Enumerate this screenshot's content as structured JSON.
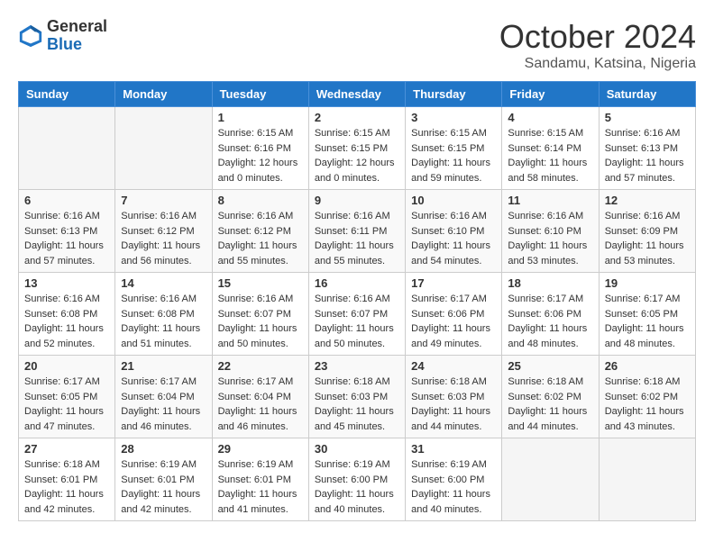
{
  "logo": {
    "general": "General",
    "blue": "Blue"
  },
  "title": "October 2024",
  "location": "Sandamu, Katsina, Nigeria",
  "headers": [
    "Sunday",
    "Monday",
    "Tuesday",
    "Wednesday",
    "Thursday",
    "Friday",
    "Saturday"
  ],
  "weeks": [
    [
      {
        "day": "",
        "info": ""
      },
      {
        "day": "",
        "info": ""
      },
      {
        "day": "1",
        "info": "Sunrise: 6:15 AM\nSunset: 6:16 PM\nDaylight: 12 hours\nand 0 minutes."
      },
      {
        "day": "2",
        "info": "Sunrise: 6:15 AM\nSunset: 6:15 PM\nDaylight: 12 hours\nand 0 minutes."
      },
      {
        "day": "3",
        "info": "Sunrise: 6:15 AM\nSunset: 6:15 PM\nDaylight: 11 hours\nand 59 minutes."
      },
      {
        "day": "4",
        "info": "Sunrise: 6:15 AM\nSunset: 6:14 PM\nDaylight: 11 hours\nand 58 minutes."
      },
      {
        "day": "5",
        "info": "Sunrise: 6:16 AM\nSunset: 6:13 PM\nDaylight: 11 hours\nand 57 minutes."
      }
    ],
    [
      {
        "day": "6",
        "info": "Sunrise: 6:16 AM\nSunset: 6:13 PM\nDaylight: 11 hours\nand 57 minutes."
      },
      {
        "day": "7",
        "info": "Sunrise: 6:16 AM\nSunset: 6:12 PM\nDaylight: 11 hours\nand 56 minutes."
      },
      {
        "day": "8",
        "info": "Sunrise: 6:16 AM\nSunset: 6:12 PM\nDaylight: 11 hours\nand 55 minutes."
      },
      {
        "day": "9",
        "info": "Sunrise: 6:16 AM\nSunset: 6:11 PM\nDaylight: 11 hours\nand 55 minutes."
      },
      {
        "day": "10",
        "info": "Sunrise: 6:16 AM\nSunset: 6:10 PM\nDaylight: 11 hours\nand 54 minutes."
      },
      {
        "day": "11",
        "info": "Sunrise: 6:16 AM\nSunset: 6:10 PM\nDaylight: 11 hours\nand 53 minutes."
      },
      {
        "day": "12",
        "info": "Sunrise: 6:16 AM\nSunset: 6:09 PM\nDaylight: 11 hours\nand 53 minutes."
      }
    ],
    [
      {
        "day": "13",
        "info": "Sunrise: 6:16 AM\nSunset: 6:08 PM\nDaylight: 11 hours\nand 52 minutes."
      },
      {
        "day": "14",
        "info": "Sunrise: 6:16 AM\nSunset: 6:08 PM\nDaylight: 11 hours\nand 51 minutes."
      },
      {
        "day": "15",
        "info": "Sunrise: 6:16 AM\nSunset: 6:07 PM\nDaylight: 11 hours\nand 50 minutes."
      },
      {
        "day": "16",
        "info": "Sunrise: 6:16 AM\nSunset: 6:07 PM\nDaylight: 11 hours\nand 50 minutes."
      },
      {
        "day": "17",
        "info": "Sunrise: 6:17 AM\nSunset: 6:06 PM\nDaylight: 11 hours\nand 49 minutes."
      },
      {
        "day": "18",
        "info": "Sunrise: 6:17 AM\nSunset: 6:06 PM\nDaylight: 11 hours\nand 48 minutes."
      },
      {
        "day": "19",
        "info": "Sunrise: 6:17 AM\nSunset: 6:05 PM\nDaylight: 11 hours\nand 48 minutes."
      }
    ],
    [
      {
        "day": "20",
        "info": "Sunrise: 6:17 AM\nSunset: 6:05 PM\nDaylight: 11 hours\nand 47 minutes."
      },
      {
        "day": "21",
        "info": "Sunrise: 6:17 AM\nSunset: 6:04 PM\nDaylight: 11 hours\nand 46 minutes."
      },
      {
        "day": "22",
        "info": "Sunrise: 6:17 AM\nSunset: 6:04 PM\nDaylight: 11 hours\nand 46 minutes."
      },
      {
        "day": "23",
        "info": "Sunrise: 6:18 AM\nSunset: 6:03 PM\nDaylight: 11 hours\nand 45 minutes."
      },
      {
        "day": "24",
        "info": "Sunrise: 6:18 AM\nSunset: 6:03 PM\nDaylight: 11 hours\nand 44 minutes."
      },
      {
        "day": "25",
        "info": "Sunrise: 6:18 AM\nSunset: 6:02 PM\nDaylight: 11 hours\nand 44 minutes."
      },
      {
        "day": "26",
        "info": "Sunrise: 6:18 AM\nSunset: 6:02 PM\nDaylight: 11 hours\nand 43 minutes."
      }
    ],
    [
      {
        "day": "27",
        "info": "Sunrise: 6:18 AM\nSunset: 6:01 PM\nDaylight: 11 hours\nand 42 minutes."
      },
      {
        "day": "28",
        "info": "Sunrise: 6:19 AM\nSunset: 6:01 PM\nDaylight: 11 hours\nand 42 minutes."
      },
      {
        "day": "29",
        "info": "Sunrise: 6:19 AM\nSunset: 6:01 PM\nDaylight: 11 hours\nand 41 minutes."
      },
      {
        "day": "30",
        "info": "Sunrise: 6:19 AM\nSunset: 6:00 PM\nDaylight: 11 hours\nand 40 minutes."
      },
      {
        "day": "31",
        "info": "Sunrise: 6:19 AM\nSunset: 6:00 PM\nDaylight: 11 hours\nand 40 minutes."
      },
      {
        "day": "",
        "info": ""
      },
      {
        "day": "",
        "info": ""
      }
    ]
  ]
}
